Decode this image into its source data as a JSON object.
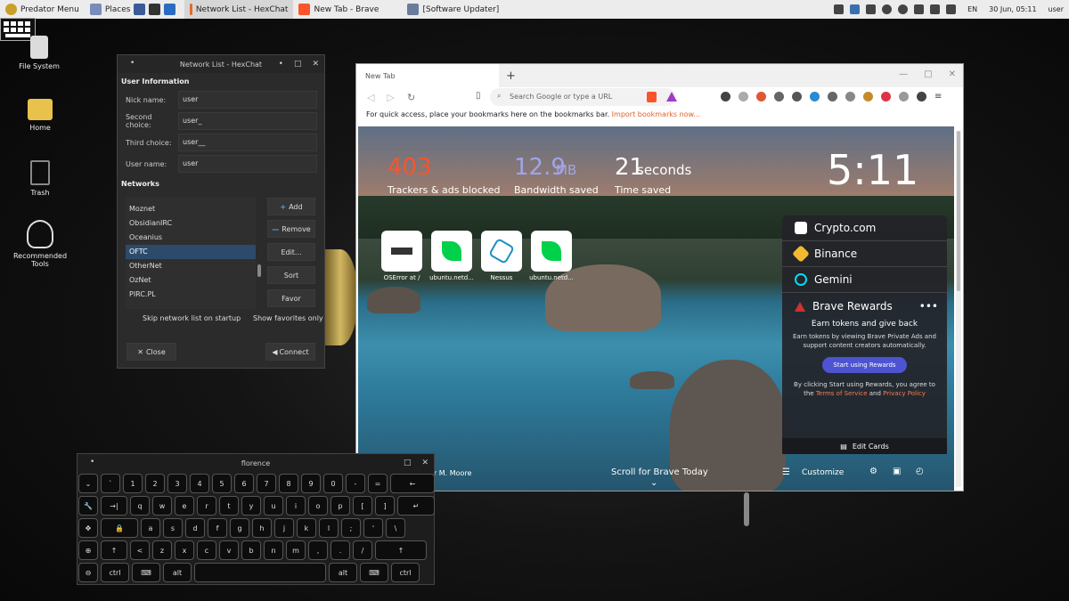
{
  "topbar": {
    "menu": "Predator Menu",
    "places": "Places",
    "tasks": [
      {
        "label": "Network List - HexChat",
        "active": true
      },
      {
        "label": "New Tab - Brave",
        "active": false
      },
      {
        "label": "[Software Updater]",
        "active": false
      }
    ],
    "lang": "EN",
    "datetime": "30 Jun, 05:11",
    "user": "user"
  },
  "desktop": {
    "icons": [
      {
        "label": "File System",
        "icon": "hdd-icon"
      },
      {
        "label": "Home",
        "icon": "home-folder-icon"
      },
      {
        "label": "Trash",
        "icon": "trash-icon"
      },
      {
        "label": "Recommended Tools",
        "icon": "predator-icon"
      }
    ]
  },
  "hexchat": {
    "title": "Network List - HexChat",
    "user_info_header": "User Information",
    "fields": [
      {
        "label": "Nick name:",
        "value": "user"
      },
      {
        "label": "Second choice:",
        "value": "user_"
      },
      {
        "label": "Third choice:",
        "value": "user__"
      },
      {
        "label": "User name:",
        "value": "user"
      }
    ],
    "networks_header": "Networks",
    "networks": [
      "Moznet",
      "ObsidianIRC",
      "Oceanius",
      "OFTC",
      "OtherNet",
      "OzNet",
      "PIRC.PL"
    ],
    "selected_network": "OFTC",
    "buttons": {
      "add": "Add",
      "remove": "Remove",
      "edit": "Edit...",
      "sort": "Sort",
      "favor": "Favor"
    },
    "skip_startup": "Skip network list on startup",
    "show_favorites": "Show favorites only",
    "close": "Close",
    "connect": "Connect"
  },
  "brave": {
    "tab_title": "New Tab",
    "url_placeholder": "Search Google or type a URL",
    "bookmark_hint": "For quick access, place your bookmarks here on the bookmarks bar.",
    "import_link": "Import bookmarks now...",
    "stats": [
      {
        "value": "403",
        "unit": "",
        "label": "Trackers & ads blocked",
        "color": "#fb542b"
      },
      {
        "value": "12.9",
        "unit": "MB",
        "label": "Bandwidth saved",
        "color": "#a0a5eb"
      },
      {
        "value": "21",
        "unit": "seconds",
        "label": "Time saved",
        "color": "#ffffff"
      }
    ],
    "clock": "5:11",
    "tiles": [
      {
        "label": "OSError at /",
        "icon": "terminal-icon"
      },
      {
        "label": "ubuntu.netd...",
        "icon": "netdata-icon"
      },
      {
        "label": "Nessus",
        "icon": "nessus-icon"
      },
      {
        "label": "ubuntu.netd...",
        "icon": "netdata-icon"
      }
    ],
    "cards": [
      {
        "name": "Crypto.com",
        "color": "#ffffff"
      },
      {
        "name": "Binance",
        "color": "#f3ba2f"
      },
      {
        "name": "Gemini",
        "color": "#00dcfa"
      }
    ],
    "rewards": {
      "title": "Brave Rewards",
      "headline": "Earn tokens and give back",
      "desc": "Earn tokens by viewing Brave Private Ads and support content creators automatically.",
      "button": "Start using Rewards",
      "terms_pre": "By clicking Start using Rewards, you agree to the",
      "terms": "Terms of Service",
      "and": "and",
      "privacy": "Privacy Policy"
    },
    "edit_cards": "Edit Cards",
    "photo_credit": "er M. Moore",
    "scroll_today": "Scroll for Brave Today",
    "customize": "Customize"
  },
  "florence": {
    "title": "florence",
    "rows": [
      [
        "⌄",
        "`",
        "1",
        "2",
        "3",
        "4",
        "5",
        "6",
        "7",
        "8",
        "9",
        "0",
        "-",
        "=",
        "←"
      ],
      [
        "🔧",
        "→|",
        "q",
        "w",
        "e",
        "r",
        "t",
        "y",
        "u",
        "i",
        "o",
        "p",
        "[",
        "]",
        "↵"
      ],
      [
        "✥",
        "🔒",
        "a",
        "s",
        "d",
        "f",
        "g",
        "h",
        "j",
        "k",
        "l",
        ";",
        "'",
        "\\"
      ],
      [
        "⊕",
        "↑",
        "<",
        "z",
        "x",
        "c",
        "v",
        "b",
        "n",
        "m",
        ",",
        ".",
        "/",
        "↑"
      ],
      [
        "⊖",
        "ctrl",
        "⌨",
        "alt",
        "",
        "alt",
        "⌨",
        "ctrl"
      ]
    ]
  }
}
